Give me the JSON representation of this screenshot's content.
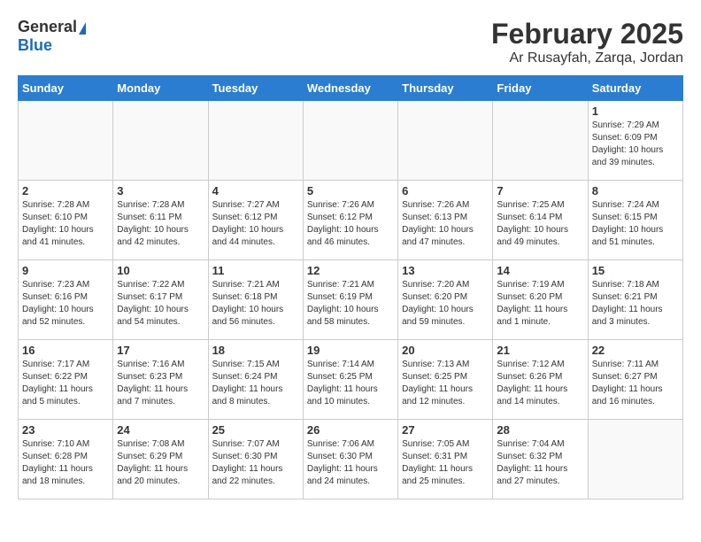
{
  "header": {
    "logo_general": "General",
    "logo_blue": "Blue",
    "title": "February 2025",
    "subtitle": "Ar Rusayfah, Zarqa, Jordan"
  },
  "calendar": {
    "days_of_week": [
      "Sunday",
      "Monday",
      "Tuesday",
      "Wednesday",
      "Thursday",
      "Friday",
      "Saturday"
    ],
    "weeks": [
      [
        {
          "day": "",
          "info": ""
        },
        {
          "day": "",
          "info": ""
        },
        {
          "day": "",
          "info": ""
        },
        {
          "day": "",
          "info": ""
        },
        {
          "day": "",
          "info": ""
        },
        {
          "day": "",
          "info": ""
        },
        {
          "day": "1",
          "info": "Sunrise: 7:29 AM\nSunset: 6:09 PM\nDaylight: 10 hours and 39 minutes."
        }
      ],
      [
        {
          "day": "2",
          "info": "Sunrise: 7:28 AM\nSunset: 6:10 PM\nDaylight: 10 hours and 41 minutes."
        },
        {
          "day": "3",
          "info": "Sunrise: 7:28 AM\nSunset: 6:11 PM\nDaylight: 10 hours and 42 minutes."
        },
        {
          "day": "4",
          "info": "Sunrise: 7:27 AM\nSunset: 6:12 PM\nDaylight: 10 hours and 44 minutes."
        },
        {
          "day": "5",
          "info": "Sunrise: 7:26 AM\nSunset: 6:12 PM\nDaylight: 10 hours and 46 minutes."
        },
        {
          "day": "6",
          "info": "Sunrise: 7:26 AM\nSunset: 6:13 PM\nDaylight: 10 hours and 47 minutes."
        },
        {
          "day": "7",
          "info": "Sunrise: 7:25 AM\nSunset: 6:14 PM\nDaylight: 10 hours and 49 minutes."
        },
        {
          "day": "8",
          "info": "Sunrise: 7:24 AM\nSunset: 6:15 PM\nDaylight: 10 hours and 51 minutes."
        }
      ],
      [
        {
          "day": "9",
          "info": "Sunrise: 7:23 AM\nSunset: 6:16 PM\nDaylight: 10 hours and 52 minutes."
        },
        {
          "day": "10",
          "info": "Sunrise: 7:22 AM\nSunset: 6:17 PM\nDaylight: 10 hours and 54 minutes."
        },
        {
          "day": "11",
          "info": "Sunrise: 7:21 AM\nSunset: 6:18 PM\nDaylight: 10 hours and 56 minutes."
        },
        {
          "day": "12",
          "info": "Sunrise: 7:21 AM\nSunset: 6:19 PM\nDaylight: 10 hours and 58 minutes."
        },
        {
          "day": "13",
          "info": "Sunrise: 7:20 AM\nSunset: 6:20 PM\nDaylight: 10 hours and 59 minutes."
        },
        {
          "day": "14",
          "info": "Sunrise: 7:19 AM\nSunset: 6:20 PM\nDaylight: 11 hours and 1 minute."
        },
        {
          "day": "15",
          "info": "Sunrise: 7:18 AM\nSunset: 6:21 PM\nDaylight: 11 hours and 3 minutes."
        }
      ],
      [
        {
          "day": "16",
          "info": "Sunrise: 7:17 AM\nSunset: 6:22 PM\nDaylight: 11 hours and 5 minutes."
        },
        {
          "day": "17",
          "info": "Sunrise: 7:16 AM\nSunset: 6:23 PM\nDaylight: 11 hours and 7 minutes."
        },
        {
          "day": "18",
          "info": "Sunrise: 7:15 AM\nSunset: 6:24 PM\nDaylight: 11 hours and 8 minutes."
        },
        {
          "day": "19",
          "info": "Sunrise: 7:14 AM\nSunset: 6:25 PM\nDaylight: 11 hours and 10 minutes."
        },
        {
          "day": "20",
          "info": "Sunrise: 7:13 AM\nSunset: 6:25 PM\nDaylight: 11 hours and 12 minutes."
        },
        {
          "day": "21",
          "info": "Sunrise: 7:12 AM\nSunset: 6:26 PM\nDaylight: 11 hours and 14 minutes."
        },
        {
          "day": "22",
          "info": "Sunrise: 7:11 AM\nSunset: 6:27 PM\nDaylight: 11 hours and 16 minutes."
        }
      ],
      [
        {
          "day": "23",
          "info": "Sunrise: 7:10 AM\nSunset: 6:28 PM\nDaylight: 11 hours and 18 minutes."
        },
        {
          "day": "24",
          "info": "Sunrise: 7:08 AM\nSunset: 6:29 PM\nDaylight: 11 hours and 20 minutes."
        },
        {
          "day": "25",
          "info": "Sunrise: 7:07 AM\nSunset: 6:30 PM\nDaylight: 11 hours and 22 minutes."
        },
        {
          "day": "26",
          "info": "Sunrise: 7:06 AM\nSunset: 6:30 PM\nDaylight: 11 hours and 24 minutes."
        },
        {
          "day": "27",
          "info": "Sunrise: 7:05 AM\nSunset: 6:31 PM\nDaylight: 11 hours and 25 minutes."
        },
        {
          "day": "28",
          "info": "Sunrise: 7:04 AM\nSunset: 6:32 PM\nDaylight: 11 hours and 27 minutes."
        },
        {
          "day": "",
          "info": ""
        }
      ]
    ]
  }
}
